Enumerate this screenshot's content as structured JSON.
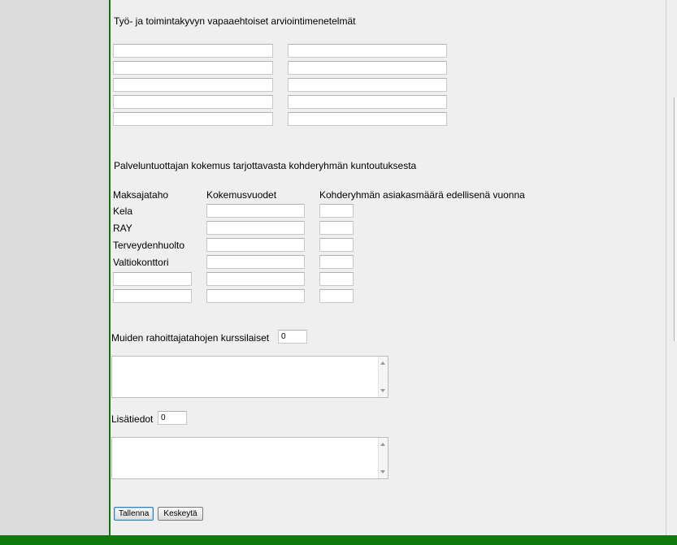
{
  "methods": {
    "title": "Työ- ja toimintakyvyn vapaaehtoiset arviointimenetelmät"
  },
  "experience": {
    "title": "Palveluntuottajan kokemus tarjottavasta kohderyhmän kuntoutuksesta",
    "columns": {
      "payer": "Maksajataho",
      "years": "Kokemusvuodet",
      "clients": "Kohderyhmän asiakasmäärä edellisenä vuonna"
    },
    "rows": [
      "Kela",
      "RAY",
      "Terveydenhuolto",
      "Valtiokonttori"
    ]
  },
  "other_funders": {
    "label": "Muiden rahoittajatahojen kurssilaiset",
    "value": "0"
  },
  "additional_info": {
    "label": "Lisätiedot",
    "value": "0"
  },
  "buttons": {
    "save": "Tallenna",
    "cancel": "Keskeytä"
  },
  "colors": {
    "frame": "#0e7a0e",
    "sidebar": "#dcdcdc",
    "content": "#efefef"
  }
}
